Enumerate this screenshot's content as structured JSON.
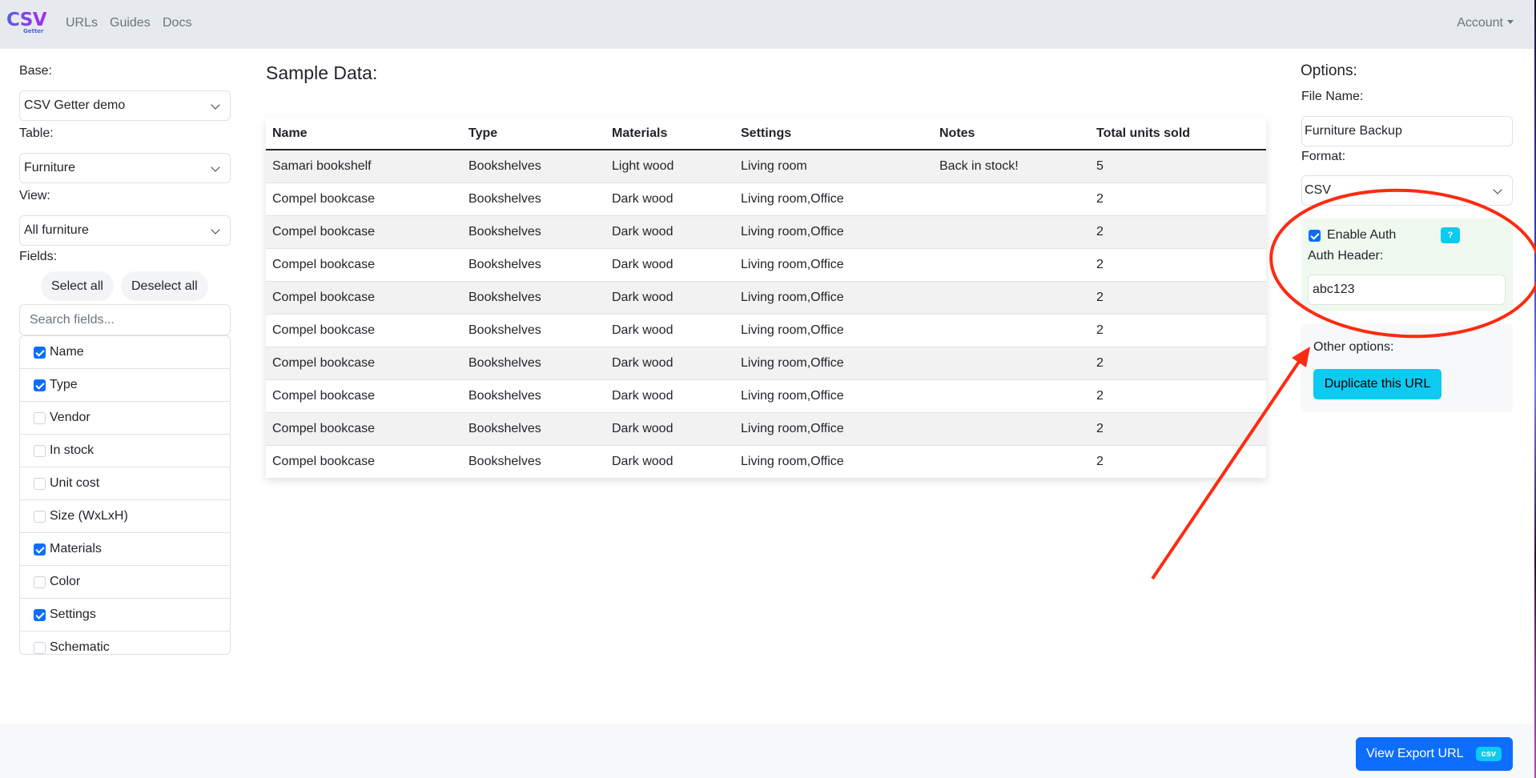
{
  "navbar": {
    "logo_main": "CSV",
    "logo_sub": "Getter",
    "links": [
      "URLs",
      "Guides",
      "Docs"
    ],
    "account": "Account"
  },
  "sidebar": {
    "base_label": "Base:",
    "base_value": "CSV Getter demo",
    "table_label": "Table:",
    "table_value": "Furniture",
    "view_label": "View:",
    "view_value": "All furniture",
    "fields_label": "Fields:",
    "select_all": "Select all",
    "deselect_all": "Deselect all",
    "search_placeholder": "Search fields...",
    "fields": [
      {
        "label": "Name",
        "checked": true
      },
      {
        "label": "Type",
        "checked": true
      },
      {
        "label": "Vendor",
        "checked": false
      },
      {
        "label": "In stock",
        "checked": false
      },
      {
        "label": "Unit cost",
        "checked": false
      },
      {
        "label": "Size (WxLxH)",
        "checked": false
      },
      {
        "label": "Materials",
        "checked": true
      },
      {
        "label": "Color",
        "checked": false
      },
      {
        "label": "Settings",
        "checked": true
      },
      {
        "label": "Schematic",
        "checked": false
      }
    ]
  },
  "main": {
    "title": "Sample Data:",
    "columns": [
      "Name",
      "Type",
      "Materials",
      "Settings",
      "Notes",
      "Total units sold"
    ],
    "rows": [
      [
        "Samari bookshelf",
        "Bookshelves",
        "Light wood",
        "Living room",
        "Back in stock!",
        "5"
      ],
      [
        "Compel bookcase",
        "Bookshelves",
        "Dark wood",
        "Living room,Office",
        "",
        "2"
      ],
      [
        "Compel bookcase",
        "Bookshelves",
        "Dark wood",
        "Living room,Office",
        "",
        "2"
      ],
      [
        "Compel bookcase",
        "Bookshelves",
        "Dark wood",
        "Living room,Office",
        "",
        "2"
      ],
      [
        "Compel bookcase",
        "Bookshelves",
        "Dark wood",
        "Living room,Office",
        "",
        "2"
      ],
      [
        "Compel bookcase",
        "Bookshelves",
        "Dark wood",
        "Living room,Office",
        "",
        "2"
      ],
      [
        "Compel bookcase",
        "Bookshelves",
        "Dark wood",
        "Living room,Office",
        "",
        "2"
      ],
      [
        "Compel bookcase",
        "Bookshelves",
        "Dark wood",
        "Living room,Office",
        "",
        "2"
      ],
      [
        "Compel bookcase",
        "Bookshelves",
        "Dark wood",
        "Living room,Office",
        "",
        "2"
      ],
      [
        "Compel bookcase",
        "Bookshelves",
        "Dark wood",
        "Living room,Office",
        "",
        "2"
      ]
    ]
  },
  "options": {
    "title": "Options:",
    "file_name_label": "File Name:",
    "file_name_value": "Furniture Backup",
    "format_label": "Format:",
    "format_value": "CSV",
    "enable_auth_label": "Enable Auth",
    "enable_auth_checked": true,
    "help_badge": "?",
    "auth_header_label": "Auth Header:",
    "auth_header_value": "abc123",
    "other_options_label": "Other options:",
    "duplicate_button": "Duplicate this URL"
  },
  "footer": {
    "export_button": "View Export URL",
    "export_badge": "csv"
  },
  "colors": {
    "primary": "#0d6efd",
    "info": "#0dcaf0",
    "annotation": "#ff2a10",
    "auth_bg": "#f0f9ef"
  }
}
